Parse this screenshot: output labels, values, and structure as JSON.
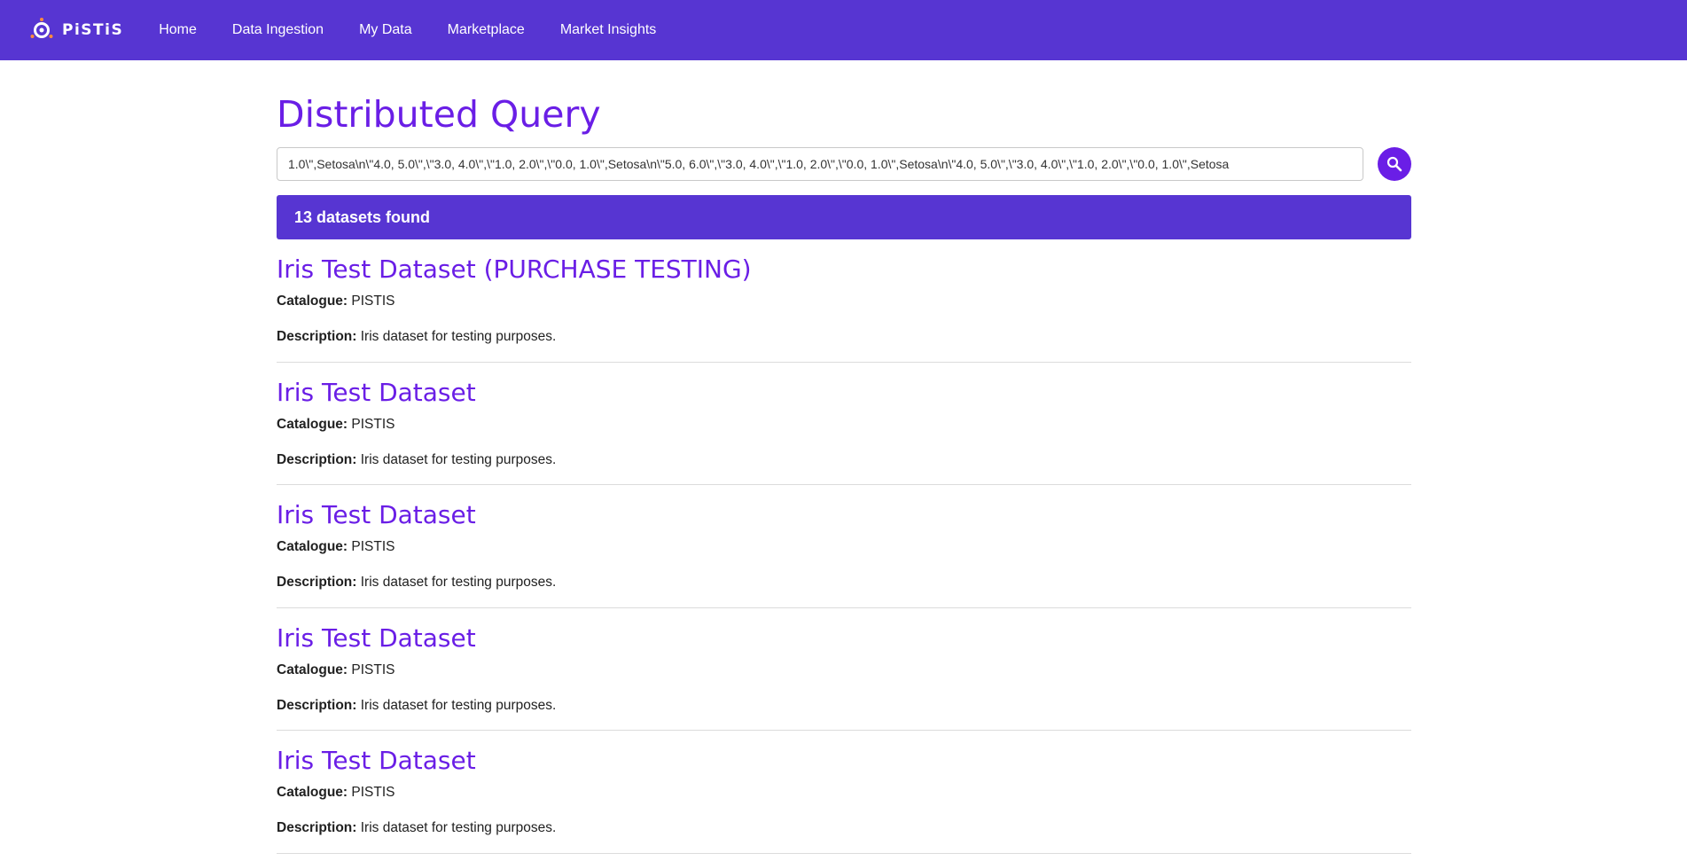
{
  "brand": {
    "name": "PiSTiS"
  },
  "nav": {
    "items": [
      {
        "label": "Home"
      },
      {
        "label": "Data Ingestion"
      },
      {
        "label": "My Data"
      },
      {
        "label": "Marketplace"
      },
      {
        "label": "Market Insights"
      }
    ]
  },
  "page": {
    "title": "Distributed Query"
  },
  "search": {
    "value": "1.0\\\",Setosa\\n\\\"4.0, 5.0\\\",\\\"3.0, 4.0\\\",\\\"1.0, 2.0\\\",\\\"0.0, 1.0\\\",Setosa\\n\\\"5.0, 6.0\\\",\\\"3.0, 4.0\\\",\\\"1.0, 2.0\\\",\\\"0.0, 1.0\\\",Setosa\\n\\\"4.0, 5.0\\\",\\\"3.0, 4.0\\\",\\\"1.0, 2.0\\\",\\\"0.0, 1.0\\\",Setosa",
    "button_icon": "search-icon"
  },
  "results": {
    "summary": "13 datasets found",
    "catalogue_label": "Catalogue:",
    "description_label": "Description:",
    "items": [
      {
        "title": "Iris Test Dataset (PURCHASE TESTING)",
        "catalogue": "PISTIS",
        "description": "Iris dataset for testing purposes."
      },
      {
        "title": "Iris Test Dataset",
        "catalogue": "PISTIS",
        "description": "Iris dataset for testing purposes."
      },
      {
        "title": "Iris Test Dataset",
        "catalogue": "PISTIS",
        "description": "Iris dataset for testing purposes."
      },
      {
        "title": "Iris Test Dataset",
        "catalogue": "PISTIS",
        "description": "Iris dataset for testing purposes."
      },
      {
        "title": "Iris Test Dataset",
        "catalogue": "PISTIS",
        "description": "Iris dataset for testing purposes."
      }
    ]
  },
  "colors": {
    "navbar": "#5735d2",
    "accent": "#6a1ee6",
    "results_bar": "#5735d2"
  }
}
